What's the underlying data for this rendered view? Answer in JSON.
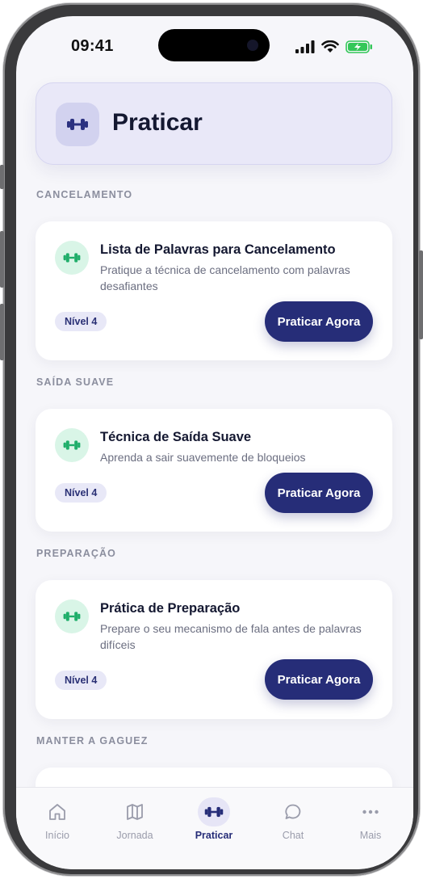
{
  "status_bar": {
    "time": "09:41"
  },
  "header": {
    "title": "Praticar"
  },
  "sections": [
    {
      "title": "CANCELAMENTO",
      "card": {
        "title": "Lista de Palavras para Cancelamento",
        "description": "Pratique a técnica de cancelamento com palavras desafiantes",
        "level": "Nível 4",
        "button": "Praticar Agora"
      }
    },
    {
      "title": "SAÍDA SUAVE",
      "card": {
        "title": "Técnica de Saída Suave",
        "description": "Aprenda a sair suavemente de bloqueios",
        "level": "Nível 4",
        "button": "Praticar Agora"
      }
    },
    {
      "title": "PREPARAÇÃO",
      "card": {
        "title": "Prática de Preparação",
        "description": "Prepare o seu mecanismo de fala antes de palavras difíceis",
        "level": "Nível 4",
        "button": "Praticar Agora"
      }
    },
    {
      "title": "MANTER A GAGUEZ"
    }
  ],
  "tabs": [
    {
      "label": "Início",
      "icon": "home-icon"
    },
    {
      "label": "Jornada",
      "icon": "map-icon"
    },
    {
      "label": "Praticar",
      "icon": "dumbbell-icon",
      "active": true
    },
    {
      "label": "Chat",
      "icon": "chat-icon"
    },
    {
      "label": "Mais",
      "icon": "more-icon"
    }
  ],
  "colors": {
    "primary": "#262d78",
    "header_bg": "#e9e8f8",
    "card_icon_bg": "#d9f5e7",
    "card_icon": "#1fae6a",
    "background": "#f6f6fa"
  }
}
